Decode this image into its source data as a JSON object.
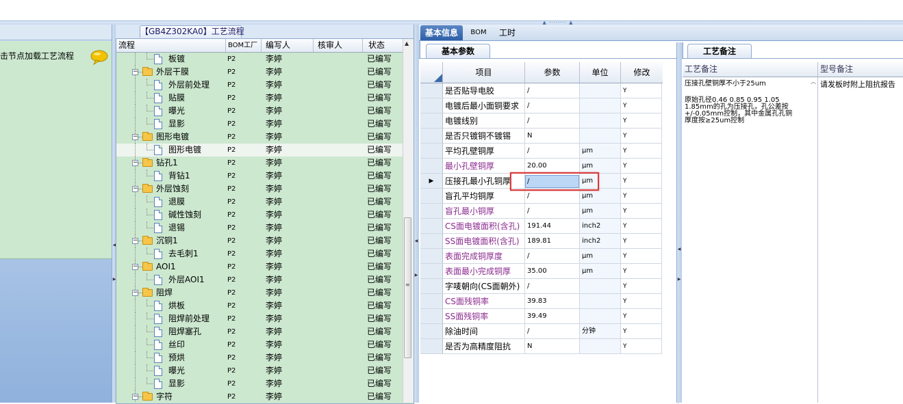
{
  "left_panel": {
    "hint": "击节点加载工艺流程",
    "icon": "speech-bubble-icon"
  },
  "tree": {
    "title": "【GB4Z302KA0】工艺流程",
    "columns": {
      "flow": "流程",
      "bom": "BOM工厂",
      "writer": "编写人",
      "reviewer": "核审人",
      "status": "状态"
    },
    "rows": [
      {
        "level": 2,
        "type": "doc",
        "label": "板镀",
        "bom": "P2",
        "writer": "李婷",
        "reviewer": "",
        "status": "已编写"
      },
      {
        "level": 1,
        "type": "folder",
        "label": "外层干膜",
        "bom": "P2",
        "writer": "李婷",
        "reviewer": "",
        "status": "已编写"
      },
      {
        "level": 2,
        "type": "doc",
        "label": "外层前处理",
        "bom": "P2",
        "writer": "李婷",
        "reviewer": "",
        "status": "已编写"
      },
      {
        "level": 2,
        "type": "doc",
        "label": "贴膜",
        "bom": "P2",
        "writer": "李婷",
        "reviewer": "",
        "status": "已编写"
      },
      {
        "level": 2,
        "type": "doc",
        "label": "曝光",
        "bom": "P2",
        "writer": "李婷",
        "reviewer": "",
        "status": "已编写"
      },
      {
        "level": 2,
        "type": "doc",
        "label": "显影",
        "bom": "P2",
        "writer": "李婷",
        "reviewer": "",
        "status": "已编写"
      },
      {
        "level": 1,
        "type": "folder",
        "label": "图形电镀",
        "bom": "P2",
        "writer": "李婷",
        "reviewer": "",
        "status": "已编写"
      },
      {
        "level": 2,
        "type": "doc",
        "label": "图形电镀",
        "bom": "P2",
        "writer": "李婷",
        "reviewer": "",
        "status": "已编写",
        "selected": true
      },
      {
        "level": 1,
        "type": "folder",
        "label": "钻孔1",
        "bom": "P2",
        "writer": "李婷",
        "reviewer": "",
        "status": "已编写"
      },
      {
        "level": 2,
        "type": "doc",
        "label": "背钻1",
        "bom": "P2",
        "writer": "李婷",
        "reviewer": "",
        "status": "已编写"
      },
      {
        "level": 1,
        "type": "folder",
        "label": "外层蚀刻",
        "bom": "P2",
        "writer": "李婷",
        "reviewer": "",
        "status": "已编写"
      },
      {
        "level": 2,
        "type": "doc",
        "label": "退膜",
        "bom": "P2",
        "writer": "李婷",
        "reviewer": "",
        "status": "已编写"
      },
      {
        "level": 2,
        "type": "doc",
        "label": "碱性蚀刻",
        "bom": "P2",
        "writer": "李婷",
        "reviewer": "",
        "status": "已编写"
      },
      {
        "level": 2,
        "type": "doc",
        "label": "退锡",
        "bom": "P2",
        "writer": "李婷",
        "reviewer": "",
        "status": "已编写"
      },
      {
        "level": 1,
        "type": "folder",
        "label": "沉铜1",
        "bom": "P2",
        "writer": "李婷",
        "reviewer": "",
        "status": "已编写"
      },
      {
        "level": 2,
        "type": "doc",
        "label": "去毛刺1",
        "bom": "P2",
        "writer": "李婷",
        "reviewer": "",
        "status": "已编写"
      },
      {
        "level": 1,
        "type": "folder",
        "label": "AOI1",
        "bom": "P2",
        "writer": "李婷",
        "reviewer": "",
        "status": "已编写"
      },
      {
        "level": 2,
        "type": "doc",
        "label": "外层AOI1",
        "bom": "P2",
        "writer": "李婷",
        "reviewer": "",
        "status": "已编写"
      },
      {
        "level": 1,
        "type": "folder",
        "label": "阻焊",
        "bom": "P2",
        "writer": "李婷",
        "reviewer": "",
        "status": "已编写"
      },
      {
        "level": 2,
        "type": "doc",
        "label": "烘板",
        "bom": "P2",
        "writer": "李婷",
        "reviewer": "",
        "status": "已编写"
      },
      {
        "level": 2,
        "type": "doc",
        "label": "阻焊前处理",
        "bom": "P2",
        "writer": "李婷",
        "reviewer": "",
        "status": "已编写"
      },
      {
        "level": 2,
        "type": "doc",
        "label": "阻焊塞孔",
        "bom": "P2",
        "writer": "李婷",
        "reviewer": "",
        "status": "已编写"
      },
      {
        "level": 2,
        "type": "doc",
        "label": "丝印",
        "bom": "P2",
        "writer": "李婷",
        "reviewer": "",
        "status": "已编写"
      },
      {
        "level": 2,
        "type": "doc",
        "label": "预烘",
        "bom": "P2",
        "writer": "李婷",
        "reviewer": "",
        "status": "已编写"
      },
      {
        "level": 2,
        "type": "doc",
        "label": "曝光",
        "bom": "P2",
        "writer": "李婷",
        "reviewer": "",
        "status": "已编写"
      },
      {
        "level": 2,
        "type": "doc",
        "label": "显影",
        "bom": "P2",
        "writer": "李婷",
        "reviewer": "",
        "status": "已编写"
      },
      {
        "level": 1,
        "type": "folder",
        "label": "字符",
        "bom": "P2",
        "writer": "李婷",
        "reviewer": "",
        "status": "已编写"
      }
    ]
  },
  "main_tabs": [
    "基本信息",
    "BOM",
    "工时"
  ],
  "params": {
    "tab_label": "基本参数",
    "columns": {
      "item": "项目",
      "param": "参数",
      "unit": "单位",
      "modify": "修改"
    },
    "rows": [
      {
        "item": "是否贴导电胶",
        "param": "/",
        "unit": "",
        "modify": "Y",
        "purple": false
      },
      {
        "item": "电镀后最小面铜要求",
        "param": "/",
        "unit": "",
        "modify": "Y",
        "purple": false
      },
      {
        "item": "电镀线别",
        "param": "/",
        "unit": "",
        "modify": "Y",
        "purple": false
      },
      {
        "item": "是否只镀铜不镀锡",
        "param": "N",
        "unit": "",
        "modify": "Y",
        "purple": false
      },
      {
        "item": "平均孔壁铜厚",
        "param": "/",
        "unit": "μm",
        "modify": "Y",
        "purple": false
      },
      {
        "item": "最小孔壁铜厚",
        "param": "20.00",
        "unit": "μm",
        "modify": "Y",
        "purple": true
      },
      {
        "item": "压接孔最小孔铜厚",
        "param": "/",
        "unit": "μm",
        "modify": "Y",
        "purple": false,
        "current": true
      },
      {
        "item": "盲孔平均铜厚",
        "param": "/",
        "unit": "μm",
        "modify": "Y",
        "purple": false
      },
      {
        "item": "盲孔最小铜厚",
        "param": "/",
        "unit": "μm",
        "modify": "Y",
        "purple": true
      },
      {
        "item": "CS面电镀面积(含孔)",
        "param": "191.44",
        "unit": "inch2",
        "modify": "Y",
        "purple": true
      },
      {
        "item": "SS面电镀面积(含孔)",
        "param": "189.81",
        "unit": "inch2",
        "modify": "Y",
        "purple": true
      },
      {
        "item": "表面完成铜厚度",
        "param": "/",
        "unit": "μm",
        "modify": "Y",
        "purple": true
      },
      {
        "item": "表面最小完成铜厚",
        "param": "35.00",
        "unit": "μm",
        "modify": "Y",
        "purple": true
      },
      {
        "item": "字唛朝向(CS面朝外)",
        "param": "/",
        "unit": "",
        "modify": "Y",
        "purple": false
      },
      {
        "item": "CS面残铜率",
        "param": "39.83",
        "unit": "",
        "modify": "Y",
        "purple": true
      },
      {
        "item": "SS面残铜率",
        "param": "39.49",
        "unit": "",
        "modify": "Y",
        "purple": true
      },
      {
        "item": "除油时间",
        "param": "/",
        "unit": "分钟",
        "modify": "Y",
        "purple": false
      },
      {
        "item": "是否为高精度阻抗",
        "param": "N",
        "unit": "",
        "modify": "Y",
        "purple": false
      }
    ],
    "editing_value": "/"
  },
  "remarks": {
    "tab_label": "工艺备注",
    "columns": {
      "process": "工艺备注",
      "model": "型号备注"
    },
    "process_lines": [
      "压接孔壁铜厚不小于25um",
      "",
      "原始孔径0.46 0.85 0.95 1.05",
      "1.85mm的孔为压接孔，孔公差按",
      "+/-0.05mm控制，其中金属孔孔铜",
      "厚度按≥25um控制"
    ],
    "model_text": "请发板时附上阻抗报告"
  },
  "colors": {
    "tree_bg": "#cce8cf",
    "purple_text": "#8b2a8f",
    "highlight": "#d93a3a",
    "tab_active": "#2e5fa8"
  }
}
